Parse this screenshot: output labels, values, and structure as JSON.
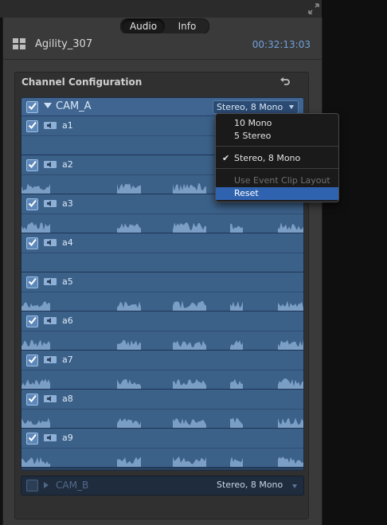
{
  "tabs": [
    {
      "label": "Audio"
    },
    {
      "label": "Info"
    }
  ],
  "header": {
    "clip_name": "Agility_307",
    "timecode": "00:32:13:03"
  },
  "section": {
    "title": "Channel Configuration"
  },
  "cam_a": {
    "name": "CAM_A",
    "config": "Stereo, 8 Mono",
    "channels": [
      {
        "label": "a1"
      },
      {
        "label": "a2"
      },
      {
        "label": "a3"
      },
      {
        "label": "a4"
      },
      {
        "label": "a5"
      },
      {
        "label": "a6"
      },
      {
        "label": "a7"
      },
      {
        "label": "a8"
      },
      {
        "label": "a9"
      }
    ]
  },
  "cam_b": {
    "name": "CAM_B",
    "config": "Stereo, 8 Mono"
  },
  "menu": {
    "items": [
      {
        "label": "10 Mono"
      },
      {
        "label": "5 Stereo"
      },
      {
        "label": "Stereo, 8 Mono",
        "checked": true
      },
      {
        "label": "Use Event Clip Layout",
        "disabled": true
      },
      {
        "label": "Reset",
        "highlighted": true
      }
    ],
    "check_glyph": "✔"
  },
  "colors": {
    "accent": "#6fa2db",
    "row": "#3c6189",
    "highlight": "#2f63b0"
  }
}
